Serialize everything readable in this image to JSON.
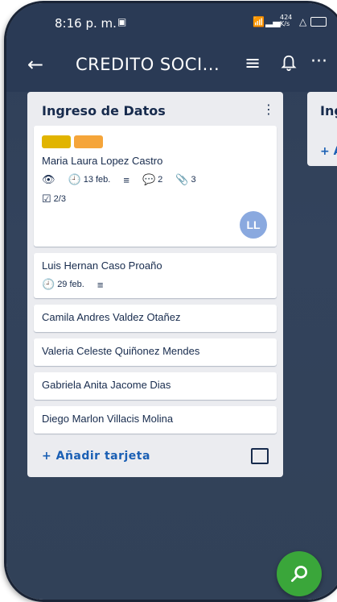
{
  "status_bar": {
    "time": "8:16 p. m.",
    "notification_icon": "app-notification-icon",
    "wifi_icon": "wifi-icon",
    "signal_icon": "signal-icon",
    "network_speed": "424 K/s",
    "alert_icon": "alert-icon",
    "battery_icon": "battery-icon"
  },
  "app_bar": {
    "back_icon": "arrow-back-icon",
    "title": "CREDITO SOCI...",
    "filter_icon": "filter-icon",
    "bell_icon": "bell-icon",
    "more_icon": "more-icon"
  },
  "list": {
    "title": "Ingreso de Datos",
    "menu_icon": "vertical-dots-icon",
    "cards": [
      {
        "title": "Maria Laura Lopez Castro",
        "labels": [
          "#e1b400",
          "#f5a53a"
        ],
        "watch": true,
        "due": "13 feb.",
        "description": true,
        "comments": "2",
        "attachments": "3",
        "checklist": "2/3",
        "avatar": "LL"
      },
      {
        "title": "Luis Hernan Caso Proaño",
        "due": "29 feb.",
        "description": true
      },
      {
        "title": "Camila Andres Valdez Otañez"
      },
      {
        "title": "Valeria Celeste Quiñonez Mendes"
      },
      {
        "title": "Gabriela Anita Jacome Dias"
      },
      {
        "title": "Diego Marlon Villacis Molina"
      }
    ],
    "add_card": "+ Añadir tarjeta"
  },
  "next_list": {
    "title": "Ing",
    "add_label": "+ A"
  },
  "fab_icon": "search-icon",
  "colors": {
    "board_background": "#33435c",
    "app_bar": "#2a3a55",
    "link": "#1a5fb4",
    "fab": "#3aa63a"
  }
}
